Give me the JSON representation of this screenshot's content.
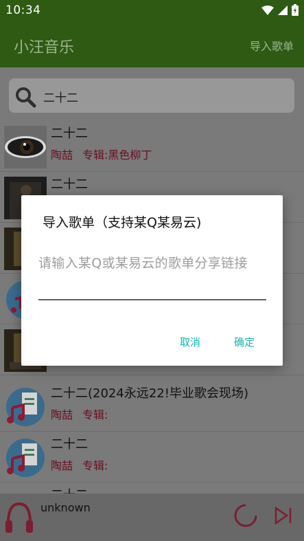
{
  "status_bar": {
    "time": "10:34",
    "icons": [
      "wifi-icon",
      "signal-icon",
      "battery-icon"
    ]
  },
  "app_bar": {
    "title": "小汪音乐",
    "import_label": "导入歌单"
  },
  "search": {
    "query": "二十二",
    "icon": "search-icon"
  },
  "songs": [
    {
      "title": "二十二",
      "artist": "陶喆",
      "album_label": "专辑:黑色柳丁"
    },
    {
      "title": "二十二",
      "artist": "",
      "album_label": ""
    },
    {
      "title": "",
      "artist": "",
      "album_label": ""
    },
    {
      "title": "",
      "artist": "",
      "album_label": ""
    },
    {
      "title": "",
      "artist": "",
      "album_label": ""
    },
    {
      "title": "二十二(2024永远22!毕业歌会现场)",
      "artist": "陶喆",
      "album_label": "专辑:"
    },
    {
      "title": "二十二",
      "artist": "陶喆",
      "album_label": "专辑:"
    },
    {
      "title": "二十二",
      "artist": "",
      "album_label": ""
    }
  ],
  "player": {
    "title": "unknown"
  },
  "dialog": {
    "title": "导入歌单（支持某Q某易云)",
    "placeholder": "请输入某Q或某易云的歌单分享链接",
    "cancel_label": "取消",
    "ok_label": "确定"
  },
  "colors": {
    "app_bar": "#4f9a20",
    "accent": "#13b5b1",
    "artist_text": "#b0173a"
  }
}
